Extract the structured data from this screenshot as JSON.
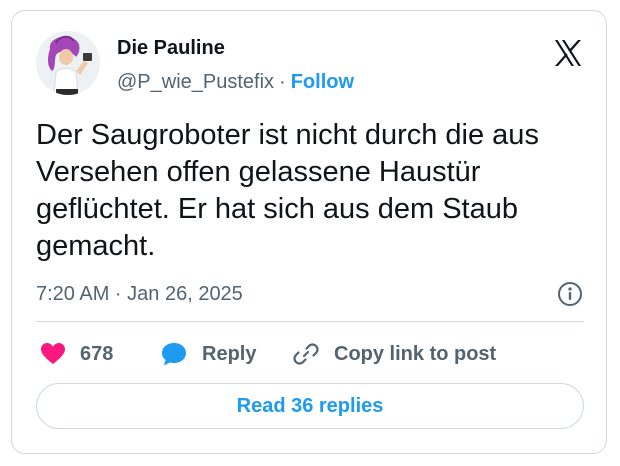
{
  "tweet": {
    "author_name": "Die Pauline",
    "handle": "@P_wie_Pustefix",
    "separator": "·",
    "follow_label": "Follow",
    "text": "Der Saugroboter ist nicht durch die aus Versehen offen gelassene Haustür geflüchtet. Er hat sich aus dem Staub gemacht.",
    "timestamp": "7:20 AM · Jan 26, 2025"
  },
  "actions": {
    "like_count": "678",
    "reply_label": "Reply",
    "copy_link_label": "Copy link to post"
  },
  "read_replies_label": "Read 36 replies",
  "icons": {
    "like": "heart-icon",
    "reply": "speech-bubble-icon",
    "copy": "link-icon",
    "info": "info-icon",
    "brand": "x-logo-icon"
  },
  "colors": {
    "accent": "#1d9bf0",
    "like": "#f91880",
    "text": "#0f1419",
    "muted": "#536471",
    "border": "#cfd9de"
  }
}
